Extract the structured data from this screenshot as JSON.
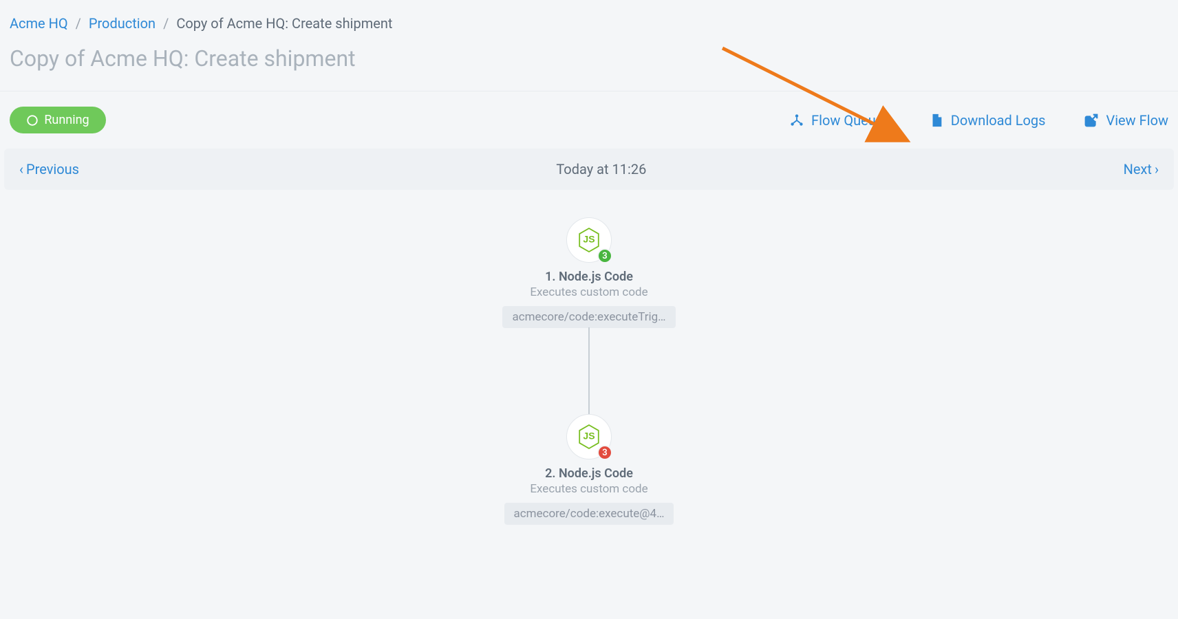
{
  "breadcrumb": {
    "org": "Acme HQ",
    "env": "Production",
    "current": "Copy of Acme HQ: Create shipment"
  },
  "page_title": "Copy of Acme HQ: Create shipment",
  "status": {
    "label": "Running"
  },
  "toolbar": {
    "flow_queues": "Flow Queues",
    "download_logs": "Download Logs",
    "view_flow": "View Flow"
  },
  "pager": {
    "previous": "Previous",
    "timestamp": "Today at 11:26",
    "next": "Next"
  },
  "nodes": [
    {
      "title": "1. Node.js Code",
      "subtitle": "Executes custom code",
      "path": "acmecore/code:executeTrig…",
      "badge_count": "3",
      "badge_color": "green"
    },
    {
      "title": "2. Node.js Code",
      "subtitle": "Executes custom code",
      "path": "acmecore/code:execute@4…",
      "badge_count": "3",
      "badge_color": "red"
    }
  ],
  "colors": {
    "link": "#2e89d6",
    "status_green": "#6fc95a",
    "badge_green": "#48b53f",
    "badge_red": "#e24b3e",
    "arrow": "#ee7a1b"
  }
}
